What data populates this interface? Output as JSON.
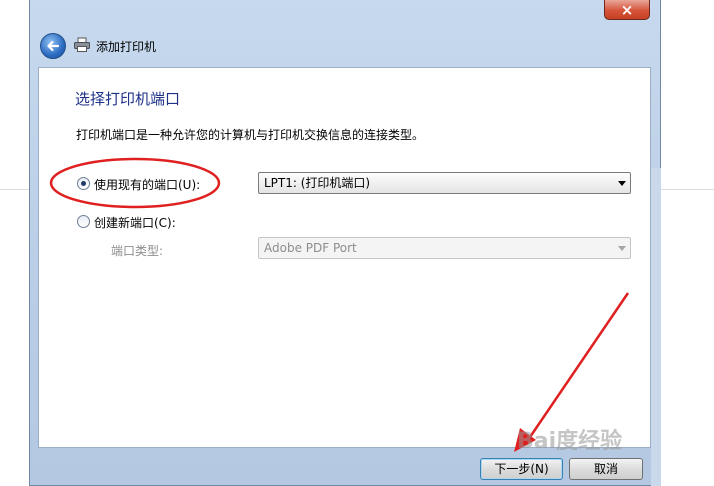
{
  "window": {
    "title": "添加打印机",
    "close_symbol": "×",
    "back_icon": "back-arrow-icon",
    "title_icon": "printer-icon"
  },
  "page": {
    "heading": "选择打印机端口",
    "description": "打印机端口是一种允许您的计算机与打印机交换信息的连接类型。"
  },
  "options": {
    "existing_port": {
      "label": "使用现有的端口(U):",
      "selected": true
    },
    "existing_port_select": {
      "value": "LPT1: (打印机端口)"
    },
    "new_port": {
      "label": "创建新端口(C):",
      "selected": false
    },
    "port_type_label": "端口类型:",
    "port_type_select": {
      "value": "Adobe PDF Port",
      "disabled": true
    }
  },
  "buttons": {
    "next_label": "下一步(N)",
    "cancel_label": "取消"
  },
  "watermark": "Bai度经验",
  "colors": {
    "heading": "#1e3287",
    "annotation": "#e02020",
    "window_frame": "#b9cde6"
  }
}
